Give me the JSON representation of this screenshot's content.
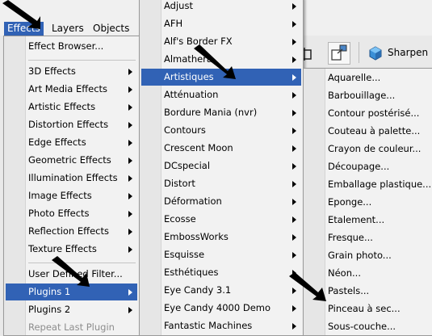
{
  "menubar": {
    "items": [
      {
        "label": "Effects",
        "name": "menubar-effects",
        "active": true
      },
      {
        "label": "Layers",
        "name": "menubar-layers"
      },
      {
        "label": "Objects",
        "name": "menubar-objects"
      }
    ]
  },
  "toolbar": {
    "sharpen_label": "Sharpen"
  },
  "effects_menu": {
    "items": [
      {
        "label": "Effect Browser...",
        "sub": false
      },
      {
        "sep": true
      },
      {
        "label": "3D Effects",
        "sub": true
      },
      {
        "label": "Art Media Effects",
        "sub": true
      },
      {
        "label": "Artistic Effects",
        "sub": true
      },
      {
        "label": "Distortion Effects",
        "sub": true
      },
      {
        "label": "Edge Effects",
        "sub": true
      },
      {
        "label": "Geometric Effects",
        "sub": true
      },
      {
        "label": "Illumination Effects",
        "sub": true
      },
      {
        "label": "Image Effects",
        "sub": true
      },
      {
        "label": "Photo Effects",
        "sub": true
      },
      {
        "label": "Reflection Effects",
        "sub": true
      },
      {
        "label": "Texture Effects",
        "sub": true
      },
      {
        "sep": true
      },
      {
        "label": "User Defined Filter...",
        "sub": false
      },
      {
        "label": "Plugins 1",
        "sub": true,
        "selected": true
      },
      {
        "label": "Plugins 2",
        "sub": true
      },
      {
        "label": "Repeat Last Plugin",
        "sub": false,
        "disabled": true
      }
    ]
  },
  "plugins_menu": {
    "items": [
      {
        "label": "Adjust",
        "sub": true
      },
      {
        "label": "AFH",
        "sub": true
      },
      {
        "label": "Alf's Border FX",
        "sub": true
      },
      {
        "label": "Almathera",
        "sub": true
      },
      {
        "label": "Artistiques",
        "sub": true,
        "selected": true
      },
      {
        "label": "Atténuation",
        "sub": true
      },
      {
        "label": "Bordure Mania (nvr)",
        "sub": true
      },
      {
        "label": "Contours",
        "sub": true
      },
      {
        "label": "Crescent Moon",
        "sub": true
      },
      {
        "label": "DCspecial",
        "sub": true
      },
      {
        "label": "Distort",
        "sub": true
      },
      {
        "label": "Déformation",
        "sub": true
      },
      {
        "label": "Ecosse",
        "sub": true
      },
      {
        "label": "EmbossWorks",
        "sub": true
      },
      {
        "label": "Esquisse",
        "sub": true
      },
      {
        "label": "Esthétiques",
        "sub": true
      },
      {
        "label": "Eye Candy 3.1",
        "sub": true
      },
      {
        "label": "Eye Candy 4000 Demo",
        "sub": true
      },
      {
        "label": "Fantastic Machines",
        "sub": true
      }
    ]
  },
  "artistiques_menu": {
    "items": [
      {
        "label": "Aquarelle..."
      },
      {
        "label": "Barbouillage..."
      },
      {
        "label": "Contour postérisé..."
      },
      {
        "label": "Couteau à palette..."
      },
      {
        "label": "Crayon de couleur..."
      },
      {
        "label": "Découpage..."
      },
      {
        "label": "Emballage plastique..."
      },
      {
        "label": "Eponge..."
      },
      {
        "label": "Etalement..."
      },
      {
        "label": "Fresque..."
      },
      {
        "label": "Grain photo..."
      },
      {
        "label": "Néon..."
      },
      {
        "label": "Pastels..."
      },
      {
        "label": "Pinceau à sec..."
      },
      {
        "label": "Sous-couche..."
      }
    ]
  },
  "colors": {
    "selection": "#3162b5",
    "menu_bg": "#f2f2f2"
  }
}
